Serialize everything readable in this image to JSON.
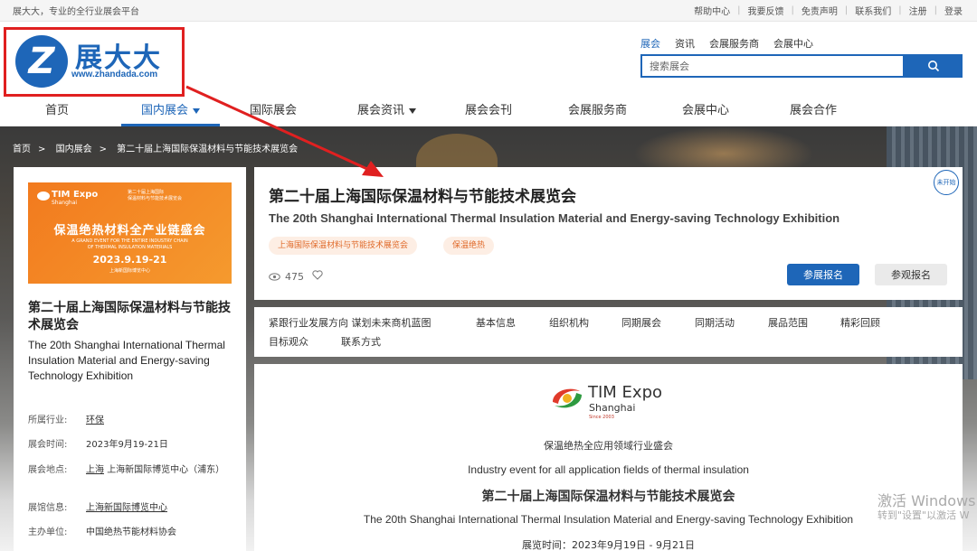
{
  "topbar": {
    "slogan": "展大大，专业的全行业展会平台",
    "links": [
      "帮助中心",
      "我要反馈",
      "免责声明",
      "联系我们",
      "注册",
      "登录"
    ]
  },
  "logo": {
    "cn": "展大大",
    "url": "www.zhandada.com",
    "mark": "Z"
  },
  "search": {
    "tabs": [
      "展会",
      "资讯",
      "会展服务商",
      "会展中心"
    ],
    "placeholder": "搜索展会"
  },
  "nav": {
    "items": [
      "首页",
      "国内展会",
      "国际展会",
      "展会资讯",
      "展会会刊",
      "会展服务商",
      "会展中心",
      "展会合作"
    ]
  },
  "breadcrumb": [
    "首页",
    "国内展会",
    "第二十届上海国际保温材料与节能技术展览会"
  ],
  "poster": {
    "brand": "TIM Expo",
    "brand_sub": "Shanghai",
    "right_line1": "第二十届上海国际",
    "right_line2": "保温材料与节能技术展览会",
    "main": "保温绝热材料全产业链盛会",
    "sub1": "A GRAND EVENT FOR THE ENTIRE INDUSTRY CHAIN",
    "sub2": "OF THERMAL INSULATION MATERIALS",
    "date": "2023.9.19-21",
    "venue": "上海新国际博览中心"
  },
  "left": {
    "title_cn": "第二十届上海国际保温材料与节能技术展览会",
    "title_en": "The 20th Shanghai International Thermal Insulation Material and Energy-saving Technology Exhibition",
    "info": {
      "industry_label": "所属行业:",
      "industry": "环保",
      "time_label": "展会时间:",
      "time": "2023年9月19-21日",
      "place_label": "展会地点:",
      "place_city": "上海",
      "place_venue": "上海新国际博览中心（浦东）",
      "hall_label": "展馆信息:",
      "hall": "上海新国际博览中心",
      "host_label": "主办单位:",
      "host": "中国绝热节能材料协会"
    }
  },
  "detail": {
    "title_cn": "第二十届上海国际保温材料与节能技术展览会",
    "title_en": "The 20th Shanghai International Thermal Insulation Material and Energy-saving Technology Exhibition",
    "tags": [
      "上海国际保温材料与节能技术展览会",
      "保温绝热"
    ],
    "status": "未开始",
    "views": "475",
    "exhibit_btn": "参展报名",
    "visit_btn": "参观报名"
  },
  "tabs": [
    "紧跟行业发展方向 谋划未来商机蓝图",
    "基本信息",
    "组织机构",
    "同期展会",
    "同期活动",
    "展品范围",
    "精彩回顾",
    "目标观众",
    "联系方式"
  ],
  "content": {
    "logo_text": "TIM Expo",
    "logo_sub": "Shanghai",
    "logo_since": "Since 2003",
    "line1": "保温绝热全应用领域行业盛会",
    "line2": "Industry event for all application fields of thermal insulation",
    "line3": "第二十届上海国际保温材料与节能技术展览会",
    "line4": "The 20th Shanghai International Thermal Insulation Material and Energy-saving Technology Exhibition",
    "line5": "展览时间：2023年9月19日 - 9月21日"
  },
  "watermark": {
    "line1": "激活 Windows",
    "line2": "转到\"设置\"以激活 W"
  },
  "colors": {
    "brand": "#1e66b8",
    "annotation": "#e02020",
    "tag_text": "#e06a2a",
    "poster": "#f27a1e"
  }
}
